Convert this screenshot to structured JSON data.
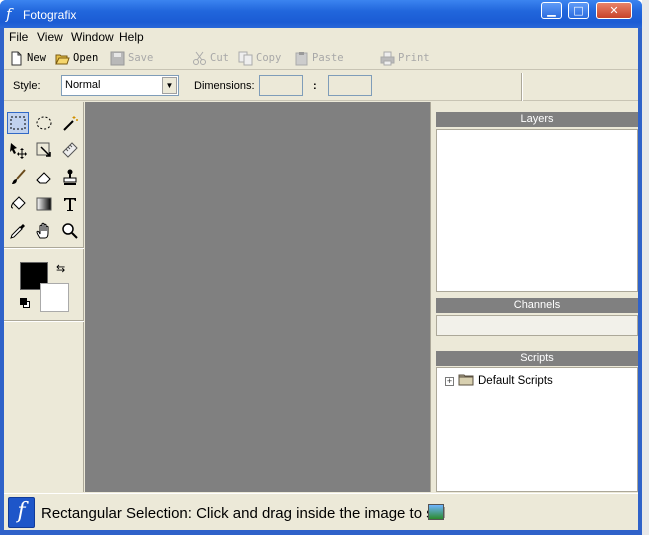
{
  "window": {
    "title": "Fotografix",
    "controls": {
      "minimize": "▁",
      "maximize": "□",
      "close": "✕"
    }
  },
  "menu": [
    "File",
    "View",
    "Window",
    "Help"
  ],
  "toolbar": {
    "new_label": "New",
    "open_label": "Open",
    "save_label": "Save",
    "cut_label": "Cut",
    "copy_label": "Copy",
    "paste_label": "Paste",
    "print_label": "Print"
  },
  "options": {
    "style_label": "Style:",
    "style_value": "Normal",
    "dimensions_label": "Dimensions:",
    "width_value": "",
    "height_value": "",
    "separator": ":"
  },
  "tools": [
    {
      "name": "rectangular-selection-icon",
      "active": true
    },
    {
      "name": "elliptical-selection-icon",
      "active": false
    },
    {
      "name": "magic-wand-icon",
      "active": false
    },
    {
      "name": "move-icon",
      "active": false
    },
    {
      "name": "crop-icon",
      "active": false
    },
    {
      "name": "measure-icon",
      "active": false
    },
    {
      "name": "brush-icon",
      "active": false
    },
    {
      "name": "eraser-icon",
      "active": false
    },
    {
      "name": "clone-stamp-icon",
      "active": false
    },
    {
      "name": "paint-bucket-icon",
      "active": false
    },
    {
      "name": "gradient-icon",
      "active": false
    },
    {
      "name": "text-icon",
      "active": false
    },
    {
      "name": "eyedropper-icon",
      "active": false
    },
    {
      "name": "hand-icon",
      "active": false
    },
    {
      "name": "zoom-icon",
      "active": false
    }
  ],
  "colors": {
    "foreground": "#000000",
    "background": "#ffffff",
    "canvas": "#808080",
    "accent": "#2166dc"
  },
  "panels": {
    "layers_title": "Layers",
    "channels_title": "Channels",
    "scripts_title": "Scripts",
    "scripts_tree": [
      {
        "label": "Default Scripts",
        "expander": "+"
      }
    ]
  },
  "status": {
    "text": "Rectangular Selection: Click and drag inside the image to sel"
  }
}
